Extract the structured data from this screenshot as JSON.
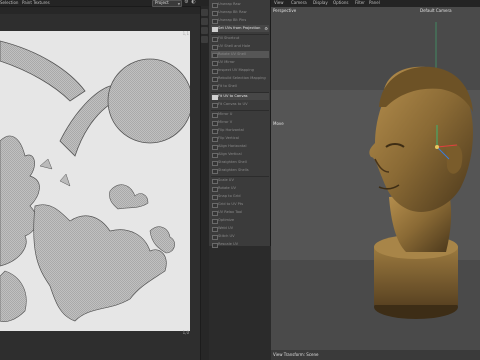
{
  "menubar": {
    "items": [
      "Selection",
      "Paint",
      "Textures"
    ],
    "project_select": "Project"
  },
  "uv": {
    "corner_top": "1,1",
    "corner_bottom": "1,0"
  },
  "commands_menu": {
    "items": [
      {
        "label": "Unwrap Raw",
        "on": false
      },
      {
        "label": "Unwrap Blt Raw",
        "on": false
      },
      {
        "label": "Unwrap Blt Pins",
        "on": false
      },
      {
        "label": "Set UVs from Projection",
        "on": true,
        "gear": true
      },
      {
        "label": "Fill Shortcut",
        "on": false
      },
      {
        "label": "UV Shell and Hole",
        "on": false
      },
      {
        "label": "Rotate UV Shell",
        "on": false,
        "highlight": true
      },
      {
        "label": "UV Mirror",
        "on": false
      },
      {
        "label": "Inspect UV Mapping",
        "on": false
      },
      {
        "label": "Rebuild Selection Mapping",
        "on": false
      },
      {
        "label": "Fit to Shell",
        "on": false
      },
      {
        "label": "Fit UV to Canvas",
        "on": true
      },
      {
        "label": "Fit Canvas to UV",
        "on": false
      },
      {
        "label": "Mirror U",
        "on": false
      },
      {
        "label": "Mirror V",
        "on": false
      },
      {
        "label": "Flip Horizontal",
        "on": false
      },
      {
        "label": "Flip Vertical",
        "on": false
      },
      {
        "label": "Align Horizontal",
        "on": false
      },
      {
        "label": "Align Vertical",
        "on": false
      },
      {
        "label": "Straighten Shell",
        "on": false
      },
      {
        "label": "Straighten Shells",
        "on": false
      },
      {
        "label": "Scale UV",
        "on": false
      },
      {
        "label": "Rotate UV",
        "on": false
      },
      {
        "label": "Snap to Grid",
        "on": false
      },
      {
        "label": "Grid to UV Pts",
        "on": false
      },
      {
        "label": "UV Relax Tool",
        "on": false
      },
      {
        "label": "Optimize",
        "on": false
      },
      {
        "label": "Weld UV",
        "on": false
      },
      {
        "label": "Stitch UV",
        "on": false
      },
      {
        "label": "Rescale UV",
        "on": false
      }
    ]
  },
  "viewport": {
    "menu": [
      "View",
      "Camera",
      "Display",
      "Options",
      "Filter",
      "Panel"
    ],
    "perspective": "Perspective",
    "camera": "Default Camera",
    "move_tool": "Move",
    "status": "View Transform: Scene"
  },
  "colors": {
    "uv_background": "#e6e6e6",
    "uv_shells": "#bdbdbd",
    "bust_base": "#8a6a35",
    "viewport_bg": "#4a4a4a"
  }
}
